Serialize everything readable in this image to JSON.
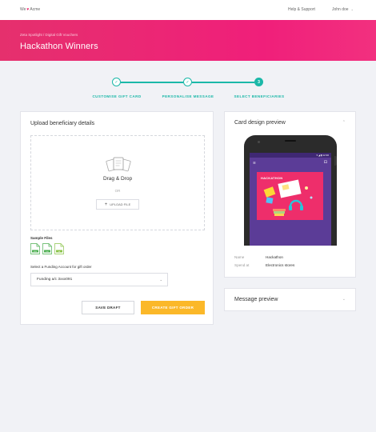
{
  "brand": {
    "prefix": "We",
    "name": "Acme"
  },
  "header": {
    "help_link": "Help & Support",
    "user_name": "John doe"
  },
  "hero": {
    "breadcrumb": "Zeta Spotlight / Digital Gift Vouchers",
    "title": "Hackathon Winners"
  },
  "stepper": {
    "steps": [
      {
        "label": "CUSTOMISE GIFT CARD",
        "state": "done",
        "marker": "✓"
      },
      {
        "label": "PERSONALISE MESSAGE",
        "state": "done",
        "marker": "✓"
      },
      {
        "label": "SELECT BENEFICIARIES",
        "state": "active",
        "marker": "3"
      }
    ]
  },
  "upload": {
    "title": "Upload beneficiary details",
    "drag_text": "Drag & Drop",
    "or_text": "OR",
    "upload_button": "UPLOAD FILE",
    "sample_files_label": "Sample Files",
    "sample_files": [
      {
        "ext": "xlsx",
        "color": "#4caf50"
      },
      {
        "ext": "csv",
        "color": "#4caf50"
      },
      {
        "ext": "txt",
        "color": "#8bc34a"
      }
    ],
    "funding_label": "Select a Funding Account  for gift order",
    "funding_value": "Funding a/c 3xxx091",
    "save_button": "SAVE DRAFT",
    "create_button": "CREATE GIFT ORDER"
  },
  "card_preview": {
    "title": "Card design preview",
    "card_text": "HACKATHON",
    "name_label": "Name",
    "name_value": "Hackathon",
    "spend_label": "Spend at",
    "spend_value": "Electronics stores"
  },
  "message_preview": {
    "title": "Message preview"
  },
  "colors": {
    "accent": "#1bb8a8",
    "brand": "#e91e63",
    "cta": "#fbb829",
    "phone_screen": "#5b3c97"
  }
}
